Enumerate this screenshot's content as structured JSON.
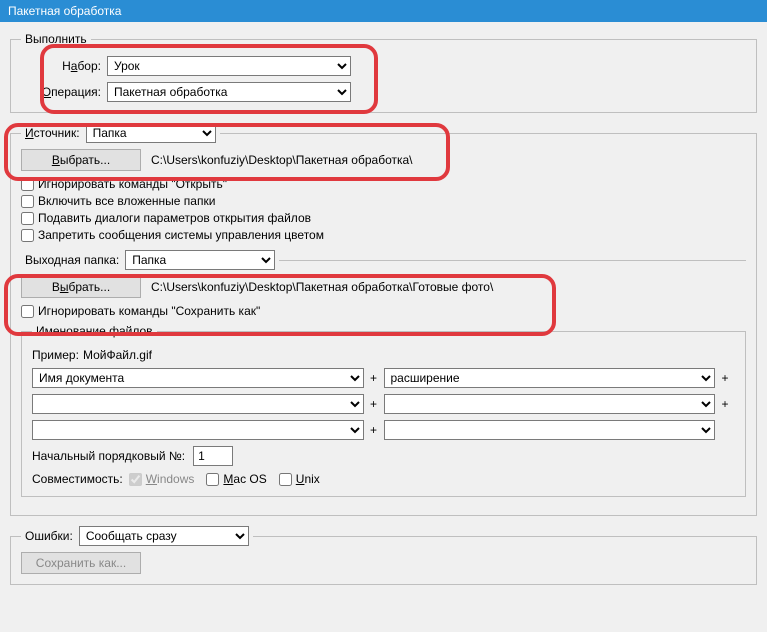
{
  "window": {
    "title": "Пакетная обработка"
  },
  "execute": {
    "legend": "Выполнить",
    "set_label_pre": "Н",
    "set_label_u": "а",
    "set_label_post": "бор:",
    "set_value": "Урок",
    "op_label_pre": "",
    "op_label_u": "О",
    "op_label_post": "перация:",
    "op_value": "Пакетная обработка"
  },
  "source": {
    "label_pre": "",
    "label_u": "И",
    "label_post": "сточник:",
    "value": "Папка",
    "choose_pre": "",
    "choose_u": "В",
    "choose_post": "ыбрать...",
    "path": "C:\\Users\\konfuziy\\Desktop\\Пакетная обработка\\",
    "cb1": "Игнорировать команды \"Открыть\"",
    "cb2": "Включить все вложенные папки",
    "cb3": "Подавить диалоги параметров открытия файлов",
    "cb4": "Запретить сообщения системы управления цветом"
  },
  "output": {
    "label": "Выходная папка:",
    "value": "Папка",
    "choose_pre": "В",
    "choose_u": "ы",
    "choose_post": "брать...",
    "path": "C:\\Users\\konfuziy\\Desktop\\Пакетная обработка\\Готовые фото\\",
    "cb_ignore": "Игнорировать команды \"Сохранить как\""
  },
  "naming": {
    "legend": "Именование файлов",
    "example_label": "Пример:",
    "example_value": "МойФайл.gif",
    "field1": "Имя документа",
    "field2": "расширение",
    "field3": "",
    "field4": "",
    "field5": "",
    "field6": "",
    "start_label": "Начальный порядковый №:",
    "start_value": "1",
    "compat_label": "Совместимость:",
    "compat_windows_pre": "",
    "compat_windows_u": "W",
    "compat_windows_post": "indows",
    "compat_mac_pre": "",
    "compat_mac_u": "M",
    "compat_mac_post": "ac OS",
    "compat_unix_pre": "",
    "compat_unix_u": "U",
    "compat_unix_post": "nix"
  },
  "errors": {
    "label": "Ошибки:",
    "value": "Сообщать сразу",
    "save_btn": "Сохранить как..."
  }
}
